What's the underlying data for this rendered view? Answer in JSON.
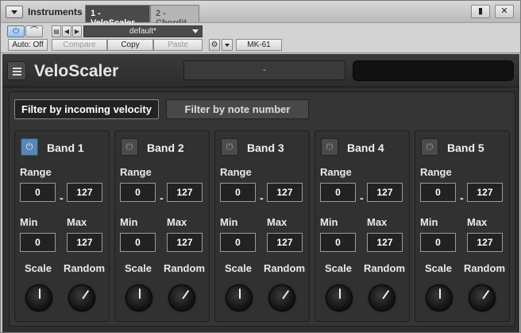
{
  "window": {
    "section_title": "Instruments",
    "tabs": [
      "1 - VeloScaler",
      "2 - Chordit"
    ],
    "pin_icon": "pin-icon",
    "close_icon": "close-icon"
  },
  "toolbar": {
    "power_glyph": "⏻",
    "auto_label": "Auto: Off",
    "compare_label": "Compare",
    "copy_label": "Copy",
    "paste_label": "Paste",
    "preset_value": "default*",
    "device_label": "MK-61",
    "active_color": "#9cc1e8"
  },
  "plugin": {
    "title": "VeloScaler",
    "center_field_value": "-",
    "tabs": {
      "velocity": "Filter by incoming velocity",
      "note": "Filter by note number"
    },
    "labels": {
      "range": "Range",
      "min": "Min",
      "max": "Max",
      "scale": "Scale",
      "random": "Random",
      "dash": "-"
    },
    "bands": [
      {
        "name": "Band 1",
        "enabled": true,
        "range_low": "0",
        "range_high": "127",
        "min": "0",
        "max": "127"
      },
      {
        "name": "Band 2",
        "enabled": false,
        "range_low": "0",
        "range_high": "127",
        "min": "0",
        "max": "127"
      },
      {
        "name": "Band 3",
        "enabled": false,
        "range_low": "0",
        "range_high": "127",
        "min": "0",
        "max": "127"
      },
      {
        "name": "Band 4",
        "enabled": false,
        "range_low": "0",
        "range_high": "127",
        "min": "0",
        "max": "127"
      },
      {
        "name": "Band 5",
        "enabled": false,
        "range_low": "0",
        "range_high": "127",
        "min": "0",
        "max": "127"
      }
    ]
  }
}
